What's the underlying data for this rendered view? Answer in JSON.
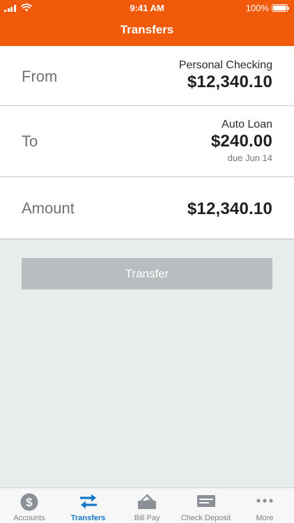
{
  "status_bar": {
    "time": "9:41 AM",
    "battery": "100%"
  },
  "nav": {
    "title": "Transfers"
  },
  "form": {
    "from": {
      "label": "From",
      "account_name": "Personal Checking",
      "amount": "$12,340.10"
    },
    "to": {
      "label": "To",
      "account_name": "Auto Loan",
      "amount": "$240.00",
      "due": "due Jun 14"
    },
    "amount": {
      "label": "Amount",
      "value": "$12,340.10"
    }
  },
  "transfer_button": {
    "label": "Transfer"
  },
  "tabbar": {
    "items": [
      {
        "label": "Accounts",
        "icon": "dollar-circle-icon"
      },
      {
        "label": "Transfers",
        "icon": "swap-arrows-icon",
        "active": true
      },
      {
        "label": "Bill Pay",
        "icon": "bill-pay-icon"
      },
      {
        "label": "Check Deposit",
        "icon": "check-icon"
      },
      {
        "label": "More",
        "icon": "more-dots-icon"
      }
    ]
  },
  "colors": {
    "brand": "#f05a0a",
    "active_tab": "#1677c9",
    "inactive": "#7c8286",
    "disabled_button": "#b9bdbf"
  }
}
